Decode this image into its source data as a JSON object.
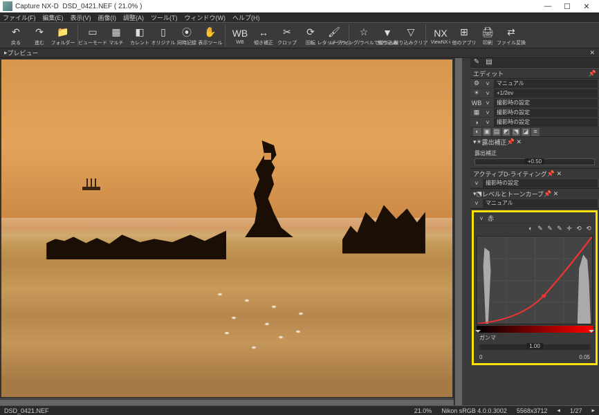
{
  "title": {
    "app": "Capture NX-D",
    "file": "DSD_0421.NEF",
    "zoom": "( 21.0% )"
  },
  "win": {
    "min": "—",
    "max": "☐",
    "close": "✕"
  },
  "menu": [
    "ファイル(F)",
    "編集(E)",
    "表示(V)",
    "画像(I)",
    "調整(A)",
    "ツール(T)",
    "ウィンドウ(W)",
    "ヘルプ(H)"
  ],
  "toolbar": [
    {
      "icon": "↶",
      "label": "戻る"
    },
    {
      "icon": "↷",
      "label": "進む"
    },
    {
      "icon": "📁",
      "label": "フォルダー"
    },
    "|",
    {
      "icon": "▭",
      "label": "ビューモード"
    },
    {
      "icon": "▦",
      "label": "マルチ"
    },
    {
      "icon": "◧",
      "label": "カレント"
    },
    {
      "icon": "▯",
      "label": "オリジナル"
    },
    {
      "icon": "⦿",
      "label": "同時記録"
    },
    {
      "icon": "✋",
      "label": "表示ツール"
    },
    "|",
    {
      "icon": "WB",
      "label": "WB"
    },
    {
      "icon": "↔",
      "label": "傾き補正"
    },
    {
      "icon": "✂",
      "label": "クロップ"
    },
    {
      "icon": "⟳",
      "label": "回転"
    },
    {
      "icon": "🖌",
      "label": "レタッチブラシ"
    },
    "|",
    {
      "icon": "☆",
      "label": "レーティング/ラベルで絞り込み"
    },
    {
      "icon": "▼",
      "label": "絞り込み"
    },
    {
      "icon": "▽",
      "label": "絞り込みクリア"
    },
    "|",
    {
      "icon": "NX",
      "label": "ViewNX-i"
    },
    {
      "icon": "⊞",
      "label": "他のアプリ"
    },
    {
      "icon": "🖨",
      "label": "印刷"
    },
    {
      "icon": "⇄",
      "label": "ファイル変換"
    }
  ],
  "prevtab": "プレビュー",
  "panel": {
    "title": "エディット",
    "rows": [
      {
        "icon": "⚙",
        "val": "マニュアル"
      },
      {
        "icon": "☀",
        "val": "+1/2ev"
      },
      {
        "icon": "WB",
        "val": "撮影時の設定"
      },
      {
        "icon": "▦",
        "val": "撮影時の設定"
      },
      {
        "icon": "◑",
        "val": "撮影時の設定"
      }
    ],
    "exposure": {
      "title": "露出補正",
      "label": "露出補正",
      "value": "+0.50"
    },
    "adl": {
      "title": "アクティブD-ライティング",
      "val": "撮影時の設定"
    },
    "lt": {
      "title": "レベルとトーンカーブ",
      "val": "マニュアル"
    },
    "channel": "赤",
    "gamma": {
      "label": "ガンマ",
      "value": "1.00",
      "min": "0",
      "max": "0.05"
    }
  },
  "status": {
    "file": "DSD_0421.NEF",
    "zoom": "21.0%",
    "profile": "Nikon sRGB 4.0.0.3002",
    "dims": "5568x3712",
    "page": "1/27"
  }
}
